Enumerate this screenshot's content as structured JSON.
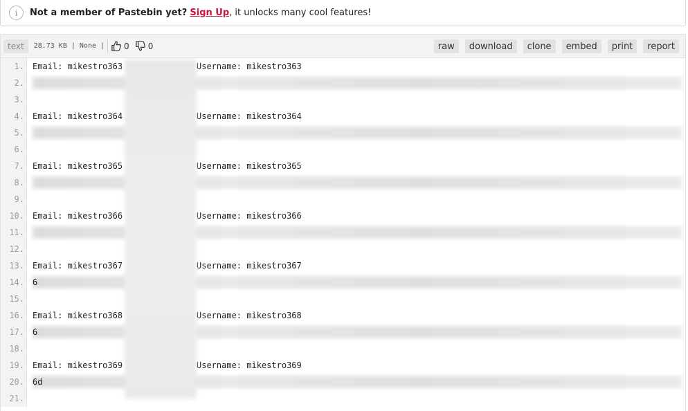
{
  "notice": {
    "icon": "info-icon",
    "message_bold": "Not a member of Pastebin yet?",
    "signup_label": "Sign Up",
    "message_rest": ", it unlocks many cool features!"
  },
  "toolbar": {
    "syntax_label": "text",
    "meta": "28.73 KB | None |",
    "likes": "0",
    "dislikes": "0",
    "actions": [
      "raw",
      "download",
      "clone",
      "embed",
      "print",
      "report"
    ]
  },
  "lines": [
    {
      "n": "1.",
      "email": "Email: mikestro363",
      "username": "Username: mikestro363"
    },
    {
      "n": "2.",
      "email": "",
      "username": "",
      "blurred": true
    },
    {
      "n": "3.",
      "email": "",
      "username": ""
    },
    {
      "n": "4.",
      "email": "Email: mikestro364",
      "username": "Username: mikestro364"
    },
    {
      "n": "5.",
      "email": "",
      "username": "",
      "blurred": true
    },
    {
      "n": "6.",
      "email": "",
      "username": ""
    },
    {
      "n": "7.",
      "email": "Email: mikestro365",
      "username": "Username: mikestro365"
    },
    {
      "n": "8.",
      "email": "",
      "username": "",
      "blurred": true
    },
    {
      "n": "9.",
      "email": "",
      "username": ""
    },
    {
      "n": "10.",
      "email": "Email: mikestro366",
      "username": "Username: mikestro366"
    },
    {
      "n": "11.",
      "email": "",
      "username": "",
      "blurred": true
    },
    {
      "n": "12.",
      "email": "",
      "username": ""
    },
    {
      "n": "13.",
      "email": "Email: mikestro367",
      "username": "Username: mikestro367"
    },
    {
      "n": "14.",
      "email": "6",
      "username": "",
      "blurred": true
    },
    {
      "n": "15.",
      "email": "",
      "username": ""
    },
    {
      "n": "16.",
      "email": "Email: mikestro368",
      "username": "Username: mikestro368"
    },
    {
      "n": "17.",
      "email": "6",
      "username": "",
      "blurred": true
    },
    {
      "n": "18.",
      "email": "",
      "username": ""
    },
    {
      "n": "19.",
      "email": "Email: mikestro369",
      "username": "Username: mikestro369"
    },
    {
      "n": "20.",
      "email": "6d",
      "username": "",
      "blurred": true
    },
    {
      "n": "21.",
      "email": "",
      "username": ""
    }
  ]
}
